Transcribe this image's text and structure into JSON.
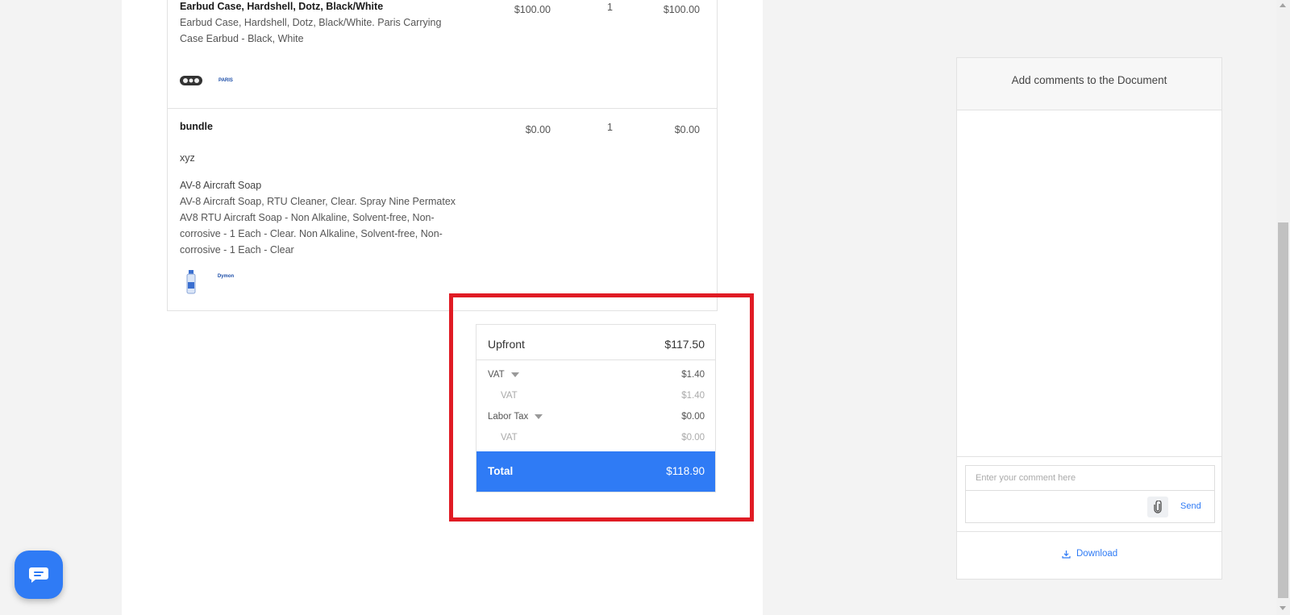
{
  "items": [
    {
      "name": "Earbud Case, Hardshell, Dotz, Black/White",
      "description": "Earbud Case, Hardshell, Dotz, Black/White. Paris Carrying Case Earbud - Black, White",
      "price": "$100.00",
      "qty": "1",
      "amount": "$100.00",
      "brand_logo_text": "PARIS"
    },
    {
      "name": "bundle",
      "subtitle": "xyz",
      "sub_item_name": "AV-8 Aircraft Soap",
      "description": "AV-8 Aircraft Soap, RTU Cleaner, Clear. Spray Nine Permatex AV8 RTU Aircraft Soap - Non Alkaline, Solvent-free, Non-corrosive - 1 Each - Clear. Non Alkaline, Solvent-free, Non-corrosive - 1 Each - Clear",
      "price": "$0.00",
      "qty": "1",
      "amount": "$0.00",
      "brand_logo_text": "Dymon"
    }
  ],
  "totals": {
    "upfront_label": "Upfront",
    "upfront_value": "$117.50",
    "taxes": [
      {
        "label": "VAT",
        "value": "$1.40",
        "expandable": true
      },
      {
        "label": "VAT",
        "value": "$1.40",
        "expandable": false
      },
      {
        "label": "Labor Tax",
        "value": "$0.00",
        "expandable": true
      },
      {
        "label": "VAT",
        "value": "$0.00",
        "expandable": false
      }
    ],
    "total_label": "Total",
    "total_value": "$118.90"
  },
  "comments": {
    "header": "Add comments to the Document",
    "input_placeholder": "Enter your comment here",
    "send_label": "Send",
    "download_label": "Download"
  },
  "colors": {
    "accent": "#2f7bf5",
    "highlight": "#e01b24"
  },
  "icons": [
    "paperclip-icon",
    "download-icon",
    "chat-icon",
    "caret-down-icon"
  ]
}
